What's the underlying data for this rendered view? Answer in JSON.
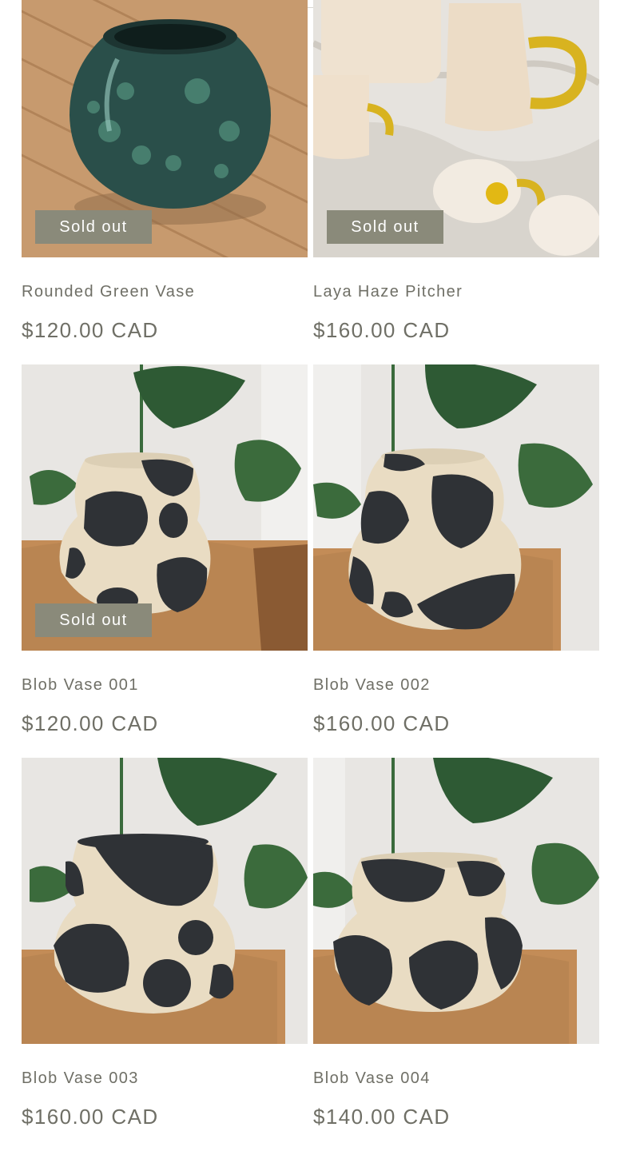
{
  "products": [
    {
      "title": "Rounded Green Vase",
      "price": "$120.00 CAD",
      "badge": "Sold out"
    },
    {
      "title": "Laya Haze Pitcher",
      "price": "$160.00 CAD",
      "badge": "Sold out"
    },
    {
      "title": "Blob Vase 001",
      "price": "$120.00 CAD",
      "badge": "Sold out"
    },
    {
      "title": "Blob Vase 002",
      "price": "$160.00 CAD",
      "badge": ""
    },
    {
      "title": "Blob Vase 003",
      "price": "$160.00 CAD",
      "badge": ""
    },
    {
      "title": "Blob Vase 004",
      "price": "$140.00 CAD",
      "badge": ""
    }
  ],
  "colors": {
    "badge_bg": "#8a8a7a",
    "text": "#6f6f66",
    "vase_black": "#2f3236",
    "vase_cream": "#e9dcc3",
    "wood": "#b98552",
    "leaf": "#2e5a34"
  }
}
